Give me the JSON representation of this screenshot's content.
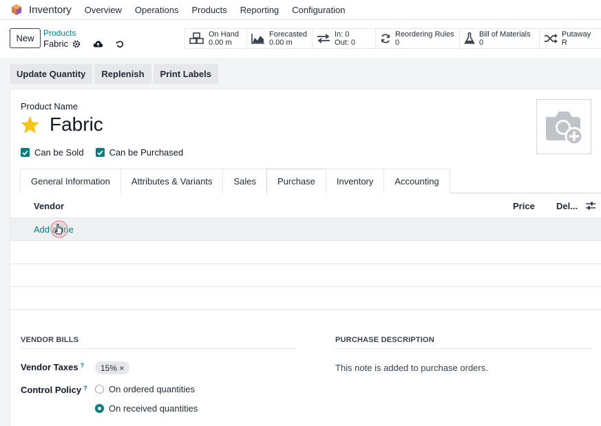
{
  "navbar": {
    "app_name": "Inventory",
    "menu": [
      "Overview",
      "Operations",
      "Products",
      "Reporting",
      "Configuration"
    ]
  },
  "control": {
    "new_label": "New",
    "breadcrumb": "Products",
    "record_name": "Fabric"
  },
  "stats": {
    "on_hand": {
      "label": "On Hand",
      "value": "0.00 m"
    },
    "forecasted": {
      "label": "Forecasted",
      "value": "0.00 m"
    },
    "in_out": {
      "in_label": "In: 0",
      "out_label": "Out: 0"
    },
    "reordering": {
      "label": "Reordering Rules",
      "value": "0"
    },
    "bom": {
      "label": "Bill of Materials",
      "value": "0"
    },
    "putaway": {
      "label": "Putaway R"
    }
  },
  "actions": [
    "Update Quantity",
    "Replenish",
    "Print Labels"
  ],
  "form": {
    "product_name_label": "Product Name",
    "product_name": "Fabric",
    "can_be_sold": "Can be Sold",
    "can_be_purchased": "Can be Purchased"
  },
  "tabs": [
    "General Information",
    "Attributes & Variants",
    "Sales",
    "Purchase",
    "Inventory",
    "Accounting"
  ],
  "active_tab": "Purchase",
  "vendor_list": {
    "col_vendor": "Vendor",
    "col_price": "Price",
    "col_delay": "Del...",
    "add_line": "Add a line"
  },
  "vendor_bills": {
    "heading": "VENDOR BILLS",
    "taxes_label": "Vendor Taxes",
    "tax_tag": "15% ×",
    "control_policy_label": "Control Policy",
    "help_mark": "?",
    "option_ordered": "On ordered quantities",
    "option_received": "On received quantities",
    "selected": "On received quantities"
  },
  "purchase_description": {
    "heading": "PURCHASE DESCRIPTION",
    "note": "This note is added to purchase orders."
  },
  "colors": {
    "accent": "#017e84",
    "star": "#f5c518",
    "logo": "#e07b39"
  }
}
